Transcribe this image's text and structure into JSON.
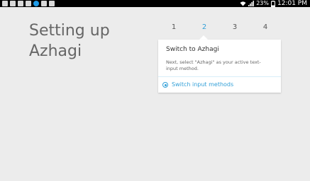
{
  "status_bar": {
    "battery": "23%",
    "time": "12:01 PM",
    "icons": [
      "picture-icon",
      "edit-icon",
      "image-icon",
      "image-icon",
      "sync-icon",
      "settings-icon",
      "box-icon",
      "wifi-icon",
      "signal-icon",
      "battery-icon"
    ]
  },
  "page": {
    "title_line1": "Setting up",
    "title_line2": "Azhagi"
  },
  "steps": [
    "1",
    "2",
    "3",
    "4"
  ],
  "active_step": "2",
  "card": {
    "title": "Switch to Azhagi",
    "description": "Next, select \"Azhagi\" as your active text-input method.",
    "option_label": "Switch input methods"
  },
  "colors": {
    "accent": "#33a0d8",
    "background": "#ececec",
    "status_bar": "#000000"
  }
}
